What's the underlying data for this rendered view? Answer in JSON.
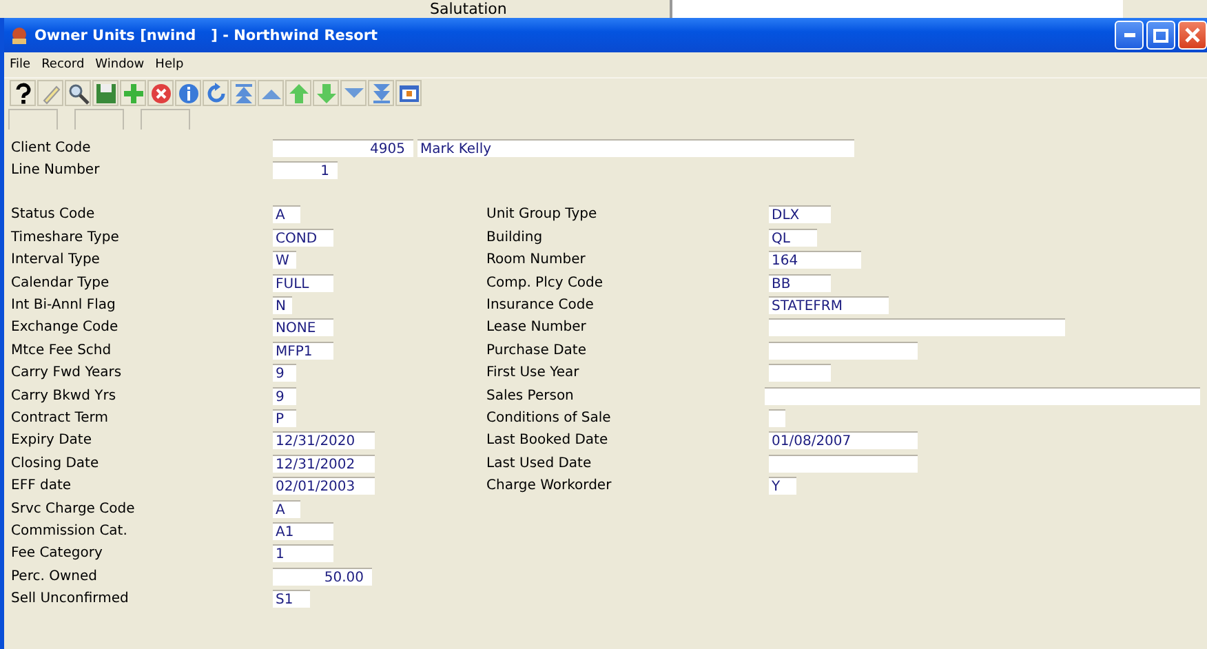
{
  "background_window": {
    "label": "Salutation"
  },
  "window": {
    "title": "Owner Units [nwind   ] - Northwind Resort"
  },
  "menu": [
    "File",
    "Record",
    "Window",
    "Help"
  ],
  "header_fields": [
    {
      "label": "Client Code",
      "value": "4905",
      "name": "Mark Kelly"
    },
    {
      "label": "Line Number",
      "value": "1"
    }
  ],
  "left_fields": [
    {
      "label": "Status Code",
      "value": "A",
      "kind": "text"
    },
    {
      "label": "Timeshare Type",
      "value": "COND",
      "kind": "text"
    },
    {
      "label": "Interval Type",
      "value": "W",
      "kind": "text"
    },
    {
      "label": "Calendar Type",
      "value": "FULL",
      "kind": "text"
    },
    {
      "label": "Int Bi-Annl Flag",
      "value": "N",
      "kind": "text"
    },
    {
      "label": "Exchange Code",
      "value": "NONE",
      "kind": "text"
    },
    {
      "label": "Mtce Fee Schd",
      "value": "MFP1",
      "kind": "text"
    },
    {
      "label": "Carry Fwd Years",
      "value": "9",
      "kind": "text"
    },
    {
      "label": "Carry Bkwd Yrs",
      "value": "9",
      "kind": "text"
    },
    {
      "label": "Contract Term",
      "value": "P",
      "kind": "text"
    },
    {
      "label": "Expiry Date",
      "value": "12/31/2020",
      "kind": "text"
    },
    {
      "label": "Closing Date",
      "value": "12/31/2002",
      "kind": "text"
    },
    {
      "label": "EFF date",
      "value": "02/01/2003",
      "kind": "text"
    },
    {
      "label": "Srvc Charge Code",
      "value": "A",
      "kind": "text"
    },
    {
      "label": "Commission Cat.",
      "value": "A1",
      "kind": "text"
    },
    {
      "label": "Fee Category",
      "value": "1",
      "kind": "text"
    },
    {
      "label": "Perc. Owned",
      "value": "50.00",
      "kind": "numeric"
    },
    {
      "label": "Sell Unconfirmed",
      "value": "S1",
      "kind": "text"
    }
  ],
  "right_fields": [
    {
      "label": "Unit Group Type",
      "value": "DLX"
    },
    {
      "label": "Building",
      "value": "QL"
    },
    {
      "label": "Room Number",
      "value": "164"
    },
    {
      "label": "Comp. Plcy Code",
      "value": "BB"
    },
    {
      "label": "Insurance Code",
      "value": "STATEFRM"
    },
    {
      "label": "Lease Number"
    },
    {
      "label": "Purchase Date"
    },
    {
      "label": "First Use Year"
    },
    {
      "label": "Sales Person"
    },
    {
      "label": "Conditions of Sale"
    },
    {
      "label": "Last Booked Date",
      "value": "01/08/2007"
    },
    {
      "label": "Last Used Date"
    },
    {
      "label": "Charge Workorder",
      "value": "Y"
    }
  ]
}
